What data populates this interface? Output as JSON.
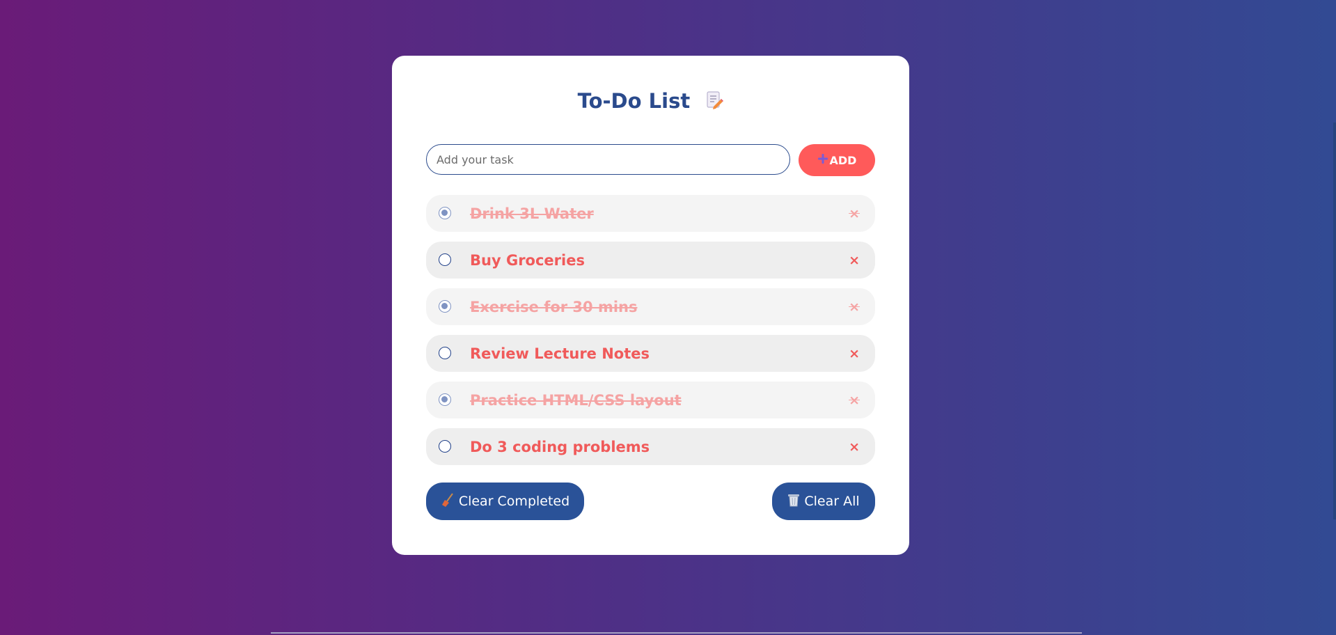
{
  "app": {
    "title": "To-Do List",
    "title_icon": "document-edit-icon"
  },
  "input": {
    "placeholder": "Add your task",
    "value": ""
  },
  "add_button": {
    "label": "ADD",
    "icon": "plus-icon"
  },
  "tasks": [
    {
      "label": "Drink 3L Water",
      "completed": true
    },
    {
      "label": "Buy Groceries",
      "completed": false
    },
    {
      "label": "Exercise for 30 mins",
      "completed": true
    },
    {
      "label": "Review Lecture Notes",
      "completed": false
    },
    {
      "label": "Practice HTML/CSS layout",
      "completed": true
    },
    {
      "label": "Do 3 coding problems",
      "completed": false
    }
  ],
  "delete_glyph": "×",
  "actions": {
    "clear_completed": {
      "label": "Clear Completed",
      "icon": "broom-icon"
    },
    "clear_all": {
      "label": "Clear All",
      "icon": "trash-icon"
    }
  },
  "colors": {
    "accent_red": "#ff5a5a",
    "primary_blue": "#2a5298",
    "title_blue": "#2a4a8c"
  }
}
